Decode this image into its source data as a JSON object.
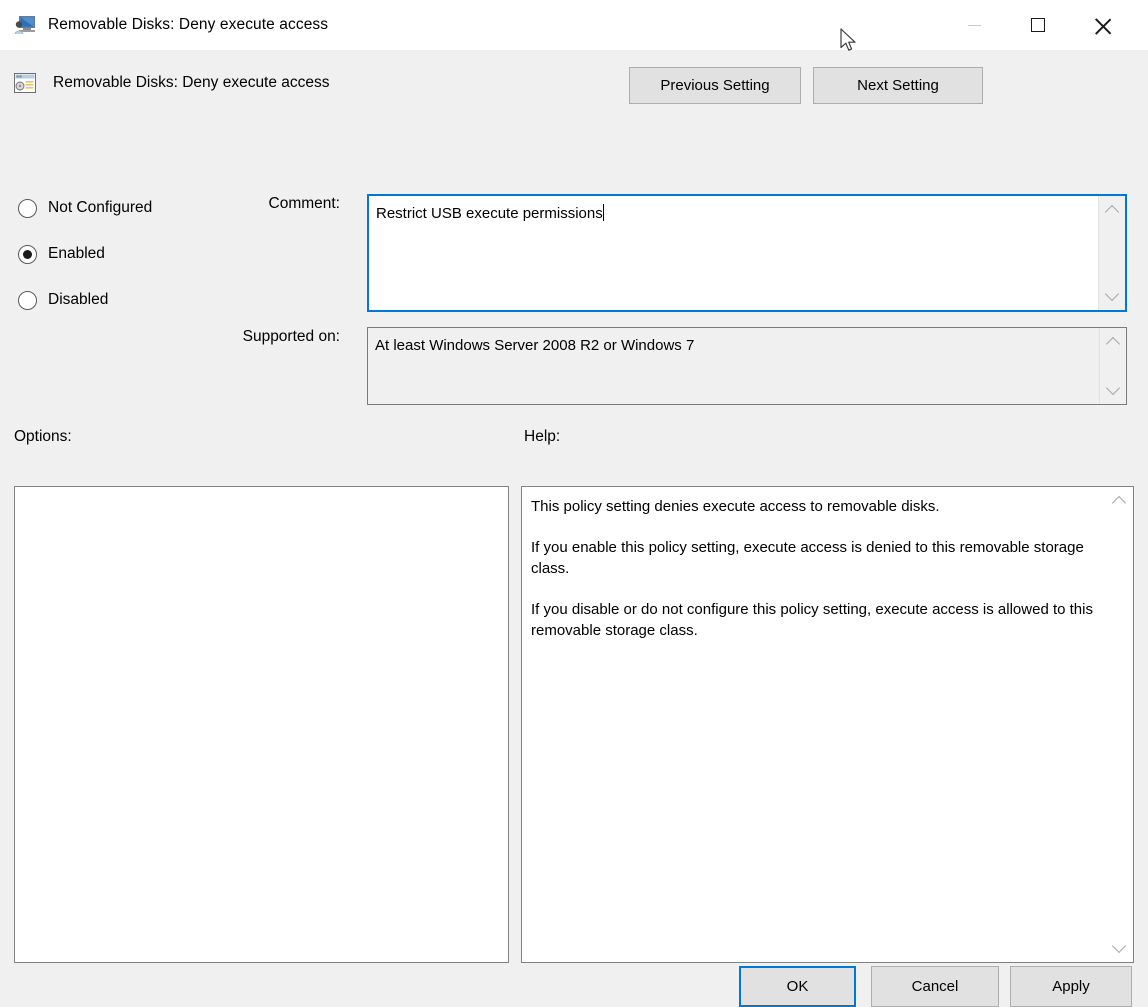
{
  "window": {
    "title": "Removable Disks: Deny execute access",
    "title_icon": "computer-user-icon",
    "controls": {
      "minimize": "minimize-icon",
      "maximize": "maximize-icon",
      "close": "close-icon"
    }
  },
  "header": {
    "policy_icon": "policy-setting-icon",
    "policy_name": "Removable Disks: Deny execute access",
    "previous_setting_label": "Previous Setting",
    "next_setting_label": "Next Setting"
  },
  "state": {
    "options": [
      {
        "label": "Not Configured",
        "selected": false
      },
      {
        "label": "Enabled",
        "selected": true
      },
      {
        "label": "Disabled",
        "selected": false
      }
    ]
  },
  "comment": {
    "label": "Comment:",
    "value": "Restrict USB execute permissions"
  },
  "supported": {
    "label": "Supported on:",
    "value": "At least Windows Server 2008 R2 or Windows 7"
  },
  "sections": {
    "options_label": "Options:",
    "help_label": "Help:"
  },
  "help": {
    "paragraphs": [
      "This policy setting denies execute access to removable disks.",
      "If you enable this policy setting, execute access is denied to this removable storage class.",
      "If you disable or do not configure this policy setting, execute access is allowed to this removable storage class."
    ]
  },
  "footer": {
    "ok_label": "OK",
    "cancel_label": "Cancel",
    "apply_label": "Apply"
  },
  "colors": {
    "accent": "#0078d7",
    "window_background": "#f0f0f0",
    "titlebar_background": "#ffffff",
    "button_face": "#e1e1e1"
  }
}
